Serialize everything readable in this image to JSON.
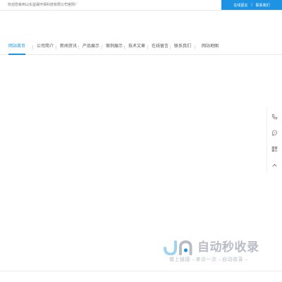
{
  "header": {
    "welcome_text": "欢迎您来到山东益晟环保科技有限公司官网！",
    "links": [
      {
        "label": "在线留言"
      },
      {
        "label": "联系我们"
      }
    ],
    "separator": "|"
  },
  "nav": {
    "items": [
      {
        "label": "网站首页",
        "active": true
      },
      {
        "label": "公司简介",
        "active": false
      },
      {
        "label": "新闻资讯",
        "active": false
      },
      {
        "label": "产品展示",
        "active": false
      },
      {
        "label": "案例展示",
        "active": false
      },
      {
        "label": "技术文章",
        "active": false
      },
      {
        "label": "在线留言",
        "active": false
      },
      {
        "label": "联系我们",
        "active": false
      },
      {
        "label": "网站地图",
        "active": false
      }
    ]
  },
  "side_tools": [
    {
      "icon": "phone-icon"
    },
    {
      "icon": "chat-icon"
    },
    {
      "icon": "qrcode-icon"
    },
    {
      "icon": "back-to-top-icon"
    }
  ],
  "watermark": {
    "title": "自动秒收录",
    "slogan": "做上链接→来访一次→自动收录→"
  },
  "colors": {
    "accent": "#1e93e4",
    "watermark": "#b9bcc6",
    "nav_text": "#555555"
  }
}
